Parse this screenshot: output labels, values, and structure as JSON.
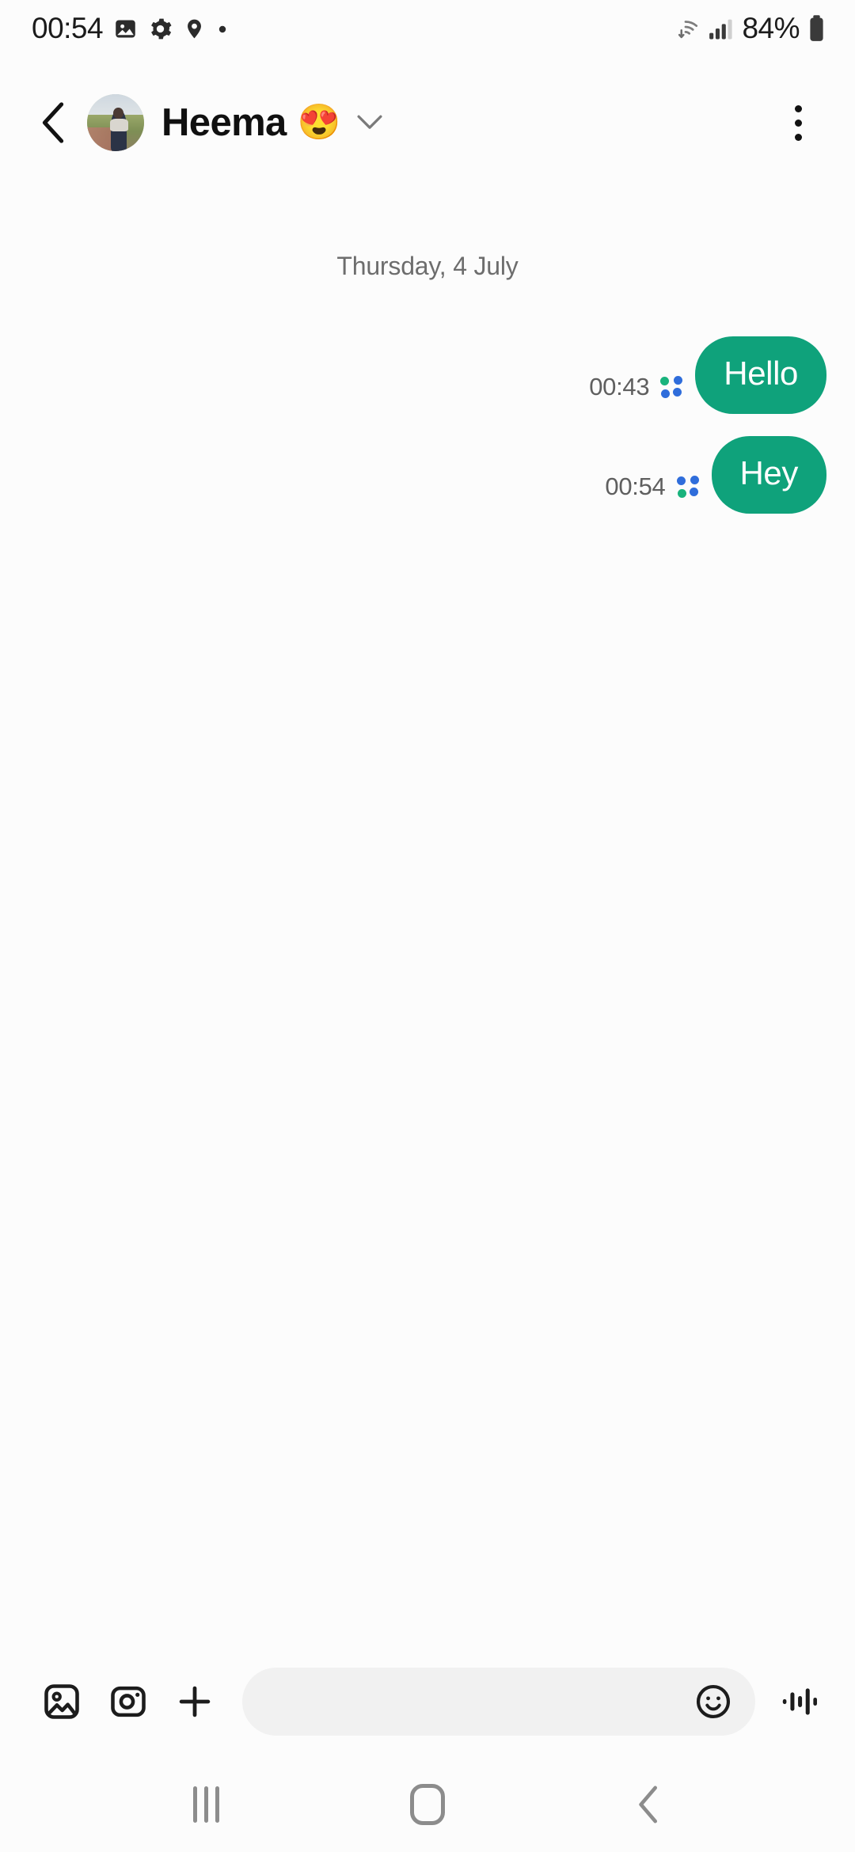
{
  "status_bar": {
    "time": "00:54",
    "battery_text": "84%",
    "left_icons": [
      "image-icon",
      "gear-icon",
      "location-pin-icon",
      "dot-icon"
    ],
    "right_icons": [
      "wifi-icon",
      "signal-icon",
      "battery-icon"
    ],
    "signal_bars_filled": 3,
    "signal_bars_total": 4
  },
  "header": {
    "back_icon": "chevron-left-icon",
    "avatar_alt": "contact-avatar",
    "title": "Heema",
    "title_emoji": "😍",
    "dropdown_icon": "chevron-down-icon",
    "overflow_icon": "more-vertical-icon"
  },
  "conversation": {
    "date_divider": "Thursday, 4 July",
    "messages": [
      {
        "text": "Hello",
        "time": "00:43",
        "side": "outgoing",
        "status": "sent",
        "status_icon": "sending-dots-icon"
      },
      {
        "text": "Hey",
        "time": "00:54",
        "side": "outgoing",
        "status": "sending",
        "status_icon": "sending-dots-icon"
      }
    ]
  },
  "composer": {
    "gallery_icon": "image-icon",
    "camera_icon": "camera-icon",
    "add_icon": "plus-icon",
    "input_value": "",
    "input_placeholder": "",
    "emoji_icon": "emoji-smiley-icon",
    "voice_icon": "voice-waveform-icon"
  },
  "navbar": {
    "recents_icon": "recents-icon",
    "home_icon": "home-icon",
    "back_icon": "chevron-left-icon"
  },
  "colors": {
    "bubble_green": "#0FA27B",
    "page_background": "#FCFCFC",
    "input_background": "#F1F1F1",
    "status_dot_blue": "#2F6DDB",
    "status_dot_green": "#19B37D",
    "nav_gray": "#8C8C8C"
  }
}
